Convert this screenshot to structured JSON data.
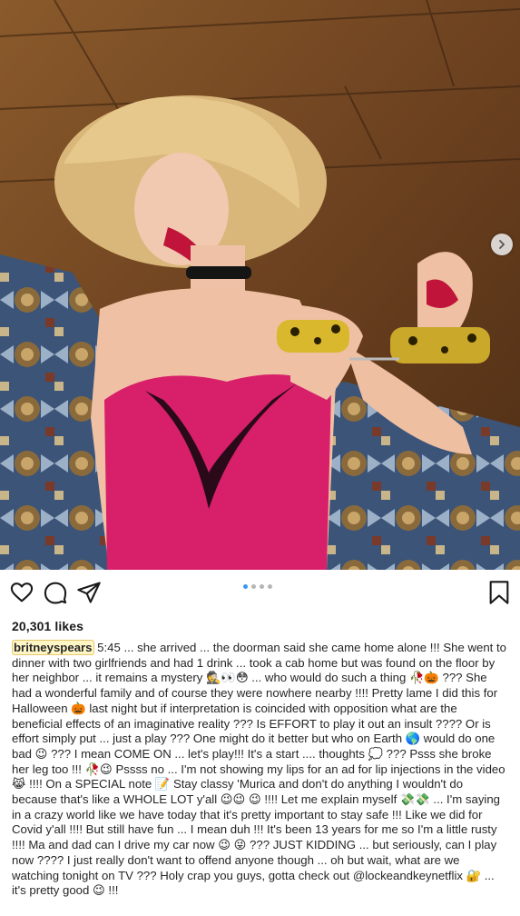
{
  "post": {
    "likes": "20,301 likes",
    "username": "britneyspears",
    "caption": " 5:45 ... she arrived ... the doorman said she came home alone !!! She went to dinner with two girlfriends and had 1 drink ... took a cab home but was found on the floor by her neighbor ... it remains a mystery 🕵️👀😳 ... who would do such a thing 🥀🎃 ??? She had a wonderful family and of course they were nowhere nearby !!!! Pretty lame I did this for Halloween 🎃 last night but if interpretation is coincided with opposition what are the beneficial effects of an imaginative reality ??? Is EFFORT to play it out an insult ???? Or is effort simply put ... just a play ??? One might do it better but who on Earth 🌎 would do one bad 😉 ??? I mean COME ON ... let's play!!! It's a start .... thoughts 💭 ??? Psss she broke her leg too !!! 🥀😉 Pssss no ... I'm not showing my lips for an ad for lip injections in the video 😹 !!!! On a SPECIAL note 📝 Stay classy 'Murica and don't do anything I wouldn't do because that's like a WHOLE LOT y'all 😉😉 😉 !!!! Let me explain myself 💸💸 ... I'm saying in a crazy world like we have today that it's pretty important to stay safe !!! Like we did for Covid y'all !!!! But still have fun ... I mean duh !!! It's been 13 years for me so I'm a little rusty !!!! Ma and dad can I drive my car now 😉 😜 ??? JUST KIDDING ... but seriously, can I play now ???? I just really don't want to offend anyone though ... oh but wait, what are we watching tonight on TV ??? Holy crap you guys, gotta check out @lockeandkeynetflix 🔐 ... it's pretty good 😉 !!!"
  },
  "carousel": {
    "total": 4,
    "active_index": 0
  },
  "icons": {
    "like": "heart-icon",
    "comment": "comment-icon",
    "share": "paper-plane-icon",
    "save": "bookmark-icon",
    "next": "chevron-right-icon"
  },
  "colors": {
    "accent_blue": "#3897f0",
    "username_highlight": "#fff6c6",
    "dress": "#d8206a",
    "text": "#262626"
  }
}
